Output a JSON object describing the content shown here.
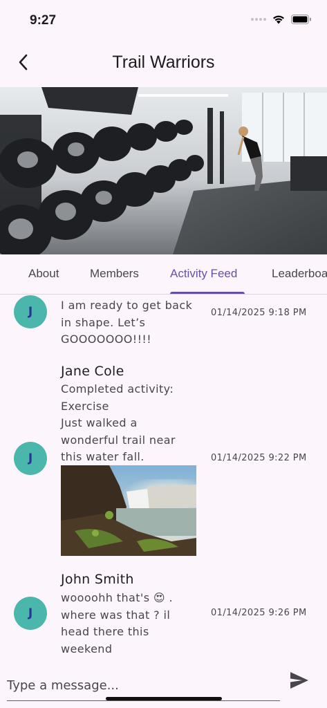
{
  "status_bar": {
    "time": "9:27"
  },
  "app_bar": {
    "title": "Trail Warriors",
    "back_icon": "chevron-left-icon"
  },
  "tabs": [
    {
      "label": "About"
    },
    {
      "label": "Members"
    },
    {
      "label": "Activity Feed",
      "active": true
    },
    {
      "label": "Leaderboard"
    }
  ],
  "feed": [
    {
      "avatar_initial": "J",
      "name": "",
      "text": "I am ready to get back\nin shape. Let’s\nGOOOOOOO!!!!",
      "timestamp": "01/14/2025 9:18 PM"
    },
    {
      "avatar_initial": "J",
      "name": "Jane Cole",
      "text": "Completed activity:\nExercise\nJust walked a\nwonderful trail near\nthis water fall.",
      "timestamp": "01/14/2025 9:22 PM",
      "has_image": true
    },
    {
      "avatar_initial": "J",
      "name": "John Smith",
      "text": "woooohh that's 😍 .\nwhere was that ? il\nhead there this\nweekend",
      "timestamp": "01/14/2025 9:26 PM"
    }
  ],
  "composer": {
    "placeholder": "Type a message...",
    "send_icon": "send-icon"
  },
  "colors": {
    "accent": "#6750a4",
    "avatar_bg": "#4bb6ac",
    "background": "#fcf6fc"
  }
}
